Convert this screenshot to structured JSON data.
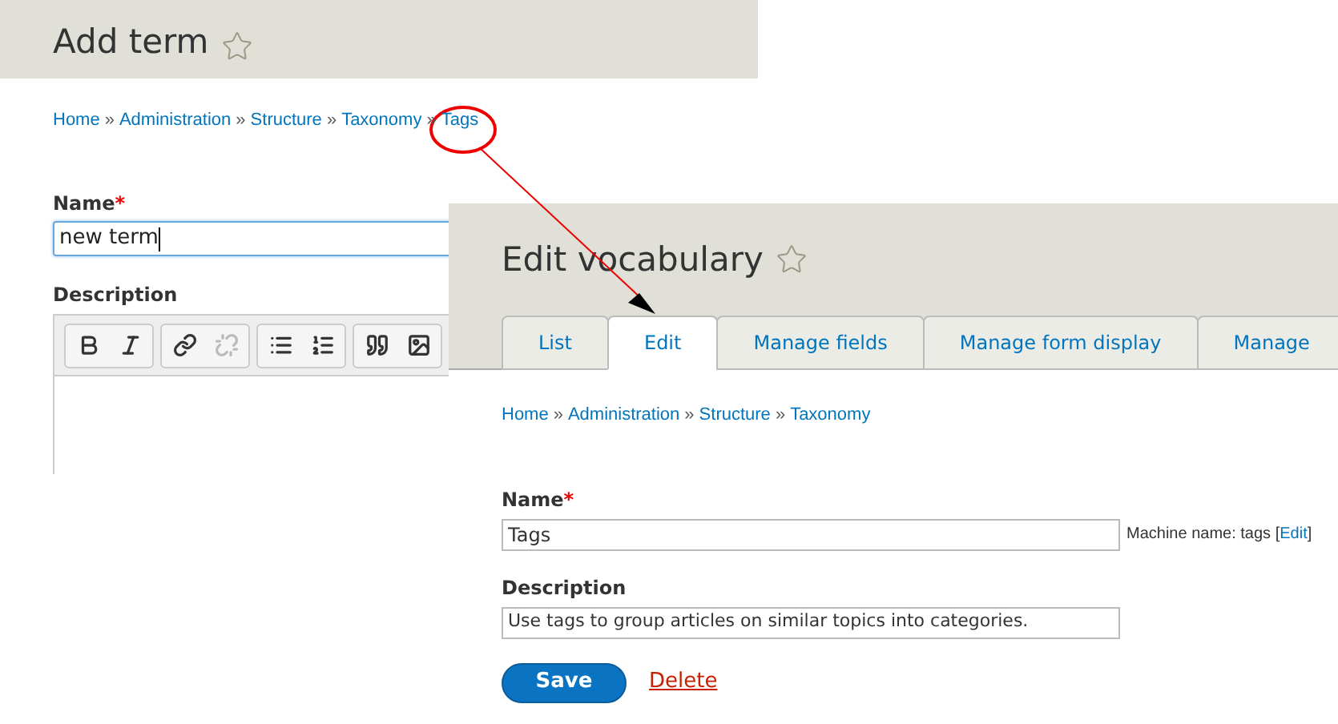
{
  "add_term_page": {
    "title": "Add term",
    "breadcrumb": [
      {
        "kind": "link",
        "text": "Home"
      },
      {
        "kind": "separator",
        "text": "»"
      },
      {
        "kind": "link",
        "text": "Administration"
      },
      {
        "kind": "separator",
        "text": "»"
      },
      {
        "kind": "link",
        "text": "Structure"
      },
      {
        "kind": "separator",
        "text": "»"
      },
      {
        "kind": "link",
        "text": "Taxonomy"
      },
      {
        "kind": "separator",
        "text": "»"
      },
      {
        "kind": "link",
        "text": "Tags"
      }
    ],
    "name_field": {
      "label": "Name",
      "required_mark": "*",
      "value": "new term"
    },
    "description_label": "Description",
    "toolbar": [
      [
        {
          "kind": "bold",
          "disabled": false
        },
        {
          "kind": "italic",
          "disabled": false
        }
      ],
      [
        {
          "kind": "link",
          "disabled": false
        },
        {
          "kind": "unlink",
          "disabled": true
        }
      ],
      [
        {
          "kind": "bullets",
          "disabled": false
        },
        {
          "kind": "numbers",
          "disabled": false
        }
      ],
      [
        {
          "kind": "quote",
          "disabled": false
        },
        {
          "kind": "image",
          "disabled": false
        }
      ]
    ]
  },
  "edit_vocabulary_page": {
    "title": "Edit vocabulary",
    "tabs": [
      {
        "label": "List",
        "selected": false
      },
      {
        "label": "Edit",
        "selected": true
      },
      {
        "label": "Manage fields",
        "selected": false
      },
      {
        "label": "Manage form display",
        "selected": false
      },
      {
        "label": "Manage",
        "selected": false
      }
    ],
    "breadcrumb": [
      {
        "kind": "link",
        "text": "Home"
      },
      {
        "kind": "separator",
        "text": "»"
      },
      {
        "kind": "link",
        "text": "Administration"
      },
      {
        "kind": "separator",
        "text": "»"
      },
      {
        "kind": "link",
        "text": "Structure"
      },
      {
        "kind": "separator",
        "text": "»"
      },
      {
        "kind": "link",
        "text": "Taxonomy"
      }
    ],
    "name_field": {
      "label": "Name",
      "required_mark": "*",
      "value": "Tags",
      "machine_name": {
        "prefix": "Machine name: tags [",
        "link": "Edit",
        "suffix": "]"
      }
    },
    "description_field": {
      "label": "Description",
      "value": "Use tags to group articles on similar topics into categories."
    },
    "buttons": [
      {
        "kind": "primary",
        "label": "Save"
      },
      {
        "kind": "danger-link",
        "label": "Delete"
      }
    ]
  }
}
